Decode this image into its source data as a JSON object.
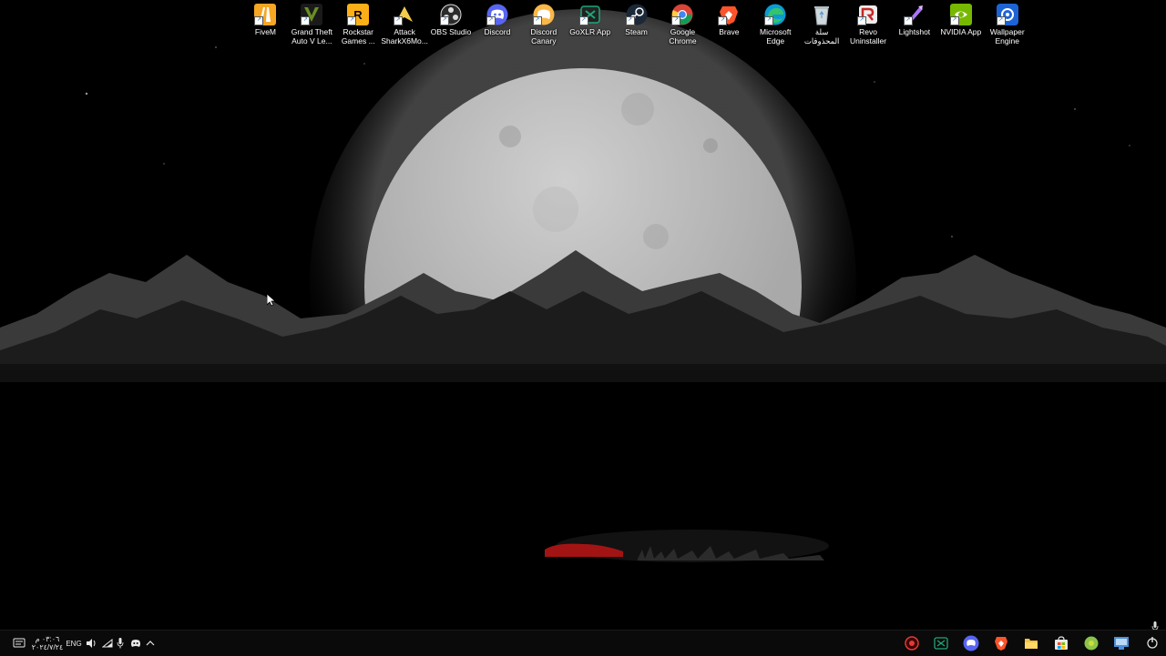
{
  "desktop": {
    "icons": [
      {
        "name": "fivem-icon",
        "label": "FiveM",
        "color": "#f5a623"
      },
      {
        "name": "gta-icon",
        "label": "Grand Theft Auto V Le...",
        "color": "#6b8e23"
      },
      {
        "name": "rockstar-icon",
        "label": "Rockstar Games ...",
        "color": "#fcaf17"
      },
      {
        "name": "attack-shark-icon",
        "label": "Attack SharkX6Mo...",
        "color": "#f2c94c"
      },
      {
        "name": "obs-icon",
        "label": "OBS Studio",
        "color": "#2b2b2b"
      },
      {
        "name": "discord-icon",
        "label": "Discord",
        "color": "#5865f2"
      },
      {
        "name": "discord-canary-icon",
        "label": "Discord Canary",
        "color": "#fbb848"
      },
      {
        "name": "goxlr-icon",
        "label": "GoXLR App",
        "color": "#1fa67a"
      },
      {
        "name": "steam-icon",
        "label": "Steam",
        "color": "#1b2838"
      },
      {
        "name": "chrome-icon",
        "label": "Google Chrome",
        "color": "#4285f4"
      },
      {
        "name": "brave-icon",
        "label": "Brave",
        "color": "#fb542b"
      },
      {
        "name": "edge-icon",
        "label": "Microsoft Edge",
        "color": "#0c9bd4"
      },
      {
        "name": "recycle-bin-icon",
        "label": "سلة المحذوفات",
        "color": "#cfd8dc"
      },
      {
        "name": "revo-icon",
        "label": "Revo Uninstaller",
        "color": "#c62828"
      },
      {
        "name": "lightshot-icon",
        "label": "Lightshot",
        "color": "#a974ff"
      },
      {
        "name": "nvidia-icon",
        "label": "NVIDIA App",
        "color": "#76b900"
      },
      {
        "name": "wallpaper-engine-icon",
        "label": "Wallpaper Engine",
        "color": "#1e63d6"
      }
    ]
  },
  "taskbar": {
    "clock_time": "٠٣:٠٦ م",
    "clock_date": "٢٠٢٤/٧/٢٤",
    "language": "ENG",
    "tray_icons": [
      "notification-icon",
      "volume-icon",
      "network-icon",
      "mic-icon",
      "discord-tray-icon",
      "show-hidden-icon"
    ],
    "pinned": [
      {
        "name": "start-icon",
        "color": "#e8e8e8"
      },
      {
        "name": "brave-taskbar-icon",
        "color": "#fb542b"
      },
      {
        "name": "discord-taskbar-icon",
        "color": "#5865f2"
      },
      {
        "name": "brave-taskbar-icon-2",
        "color": "#fb542b"
      },
      {
        "name": "file-explorer-icon",
        "color": "#f4c242"
      },
      {
        "name": "store-icon",
        "color": "#e8e8e8"
      },
      {
        "name": "razer-icon",
        "color": "#8bc34a"
      },
      {
        "name": "app-icon",
        "color": "#4a90d9"
      },
      {
        "name": "goxlr-taskbar-icon",
        "color": "#1fa67a"
      },
      {
        "name": "record-icon",
        "color": "#e53935"
      }
    ]
  }
}
